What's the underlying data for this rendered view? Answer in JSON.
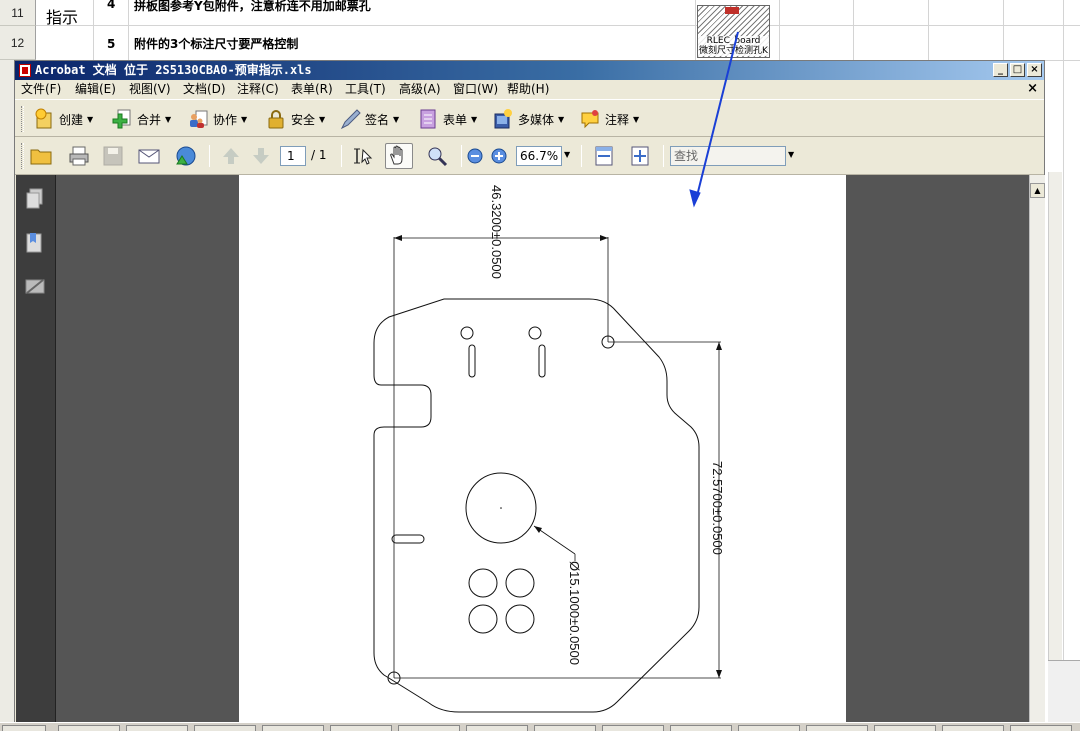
{
  "spreadsheet": {
    "row_labels": [
      "11",
      "12"
    ],
    "category_label": "指示",
    "rows": [
      {
        "num": "4",
        "text": "拼板图参考Y包附件，注意析连不用加邮票孔"
      },
      {
        "num": "5",
        "text": "附件的3个标注尺寸要严格控制"
      }
    ],
    "embedded_object_caption": "RLEC_board\n微刻尺寸检测孔K"
  },
  "window": {
    "title": "Acrobat 文档 位于 2S5130CBA0-预审指示.xls",
    "controls": {
      "minimize": "_",
      "maximize": "□",
      "close": "×"
    },
    "doc_close": "×"
  },
  "menubar": {
    "items": [
      "文件(F)",
      "编辑(E)",
      "视图(V)",
      "文档(D)",
      "注释(C)",
      "表单(R)",
      "工具(T)",
      "高级(A)",
      "窗口(W)",
      "帮助(H)"
    ]
  },
  "toolbar_tasks": {
    "items": [
      {
        "label": "创建",
        "icon": "create-pdf-icon"
      },
      {
        "label": "合并",
        "icon": "combine-icon"
      },
      {
        "label": "协作",
        "icon": "collaborate-icon"
      },
      {
        "label": "安全",
        "icon": "lock-icon"
      },
      {
        "label": "签名",
        "icon": "pen-icon"
      },
      {
        "label": "表单",
        "icon": "form-icon"
      },
      {
        "label": "多媒体",
        "icon": "multimedia-icon"
      },
      {
        "label": "注释",
        "icon": "comment-icon"
      }
    ]
  },
  "toolbar_nav": {
    "page_current": "1",
    "page_total": "/ 1",
    "zoom": "66.7%",
    "find_placeholder": "查找"
  },
  "drawing": {
    "dim_top": "46.3200±0.0500",
    "dim_right": "72.5700±0.0500",
    "dim_circle": "Ø15.1000±0.0500"
  },
  "colors": {
    "title_start": "#0a246a",
    "title_end": "#a6caf0",
    "chrome": "#ece9d8",
    "doc_bg": "#555555",
    "annotation_arrow": "#1a3fd6"
  }
}
